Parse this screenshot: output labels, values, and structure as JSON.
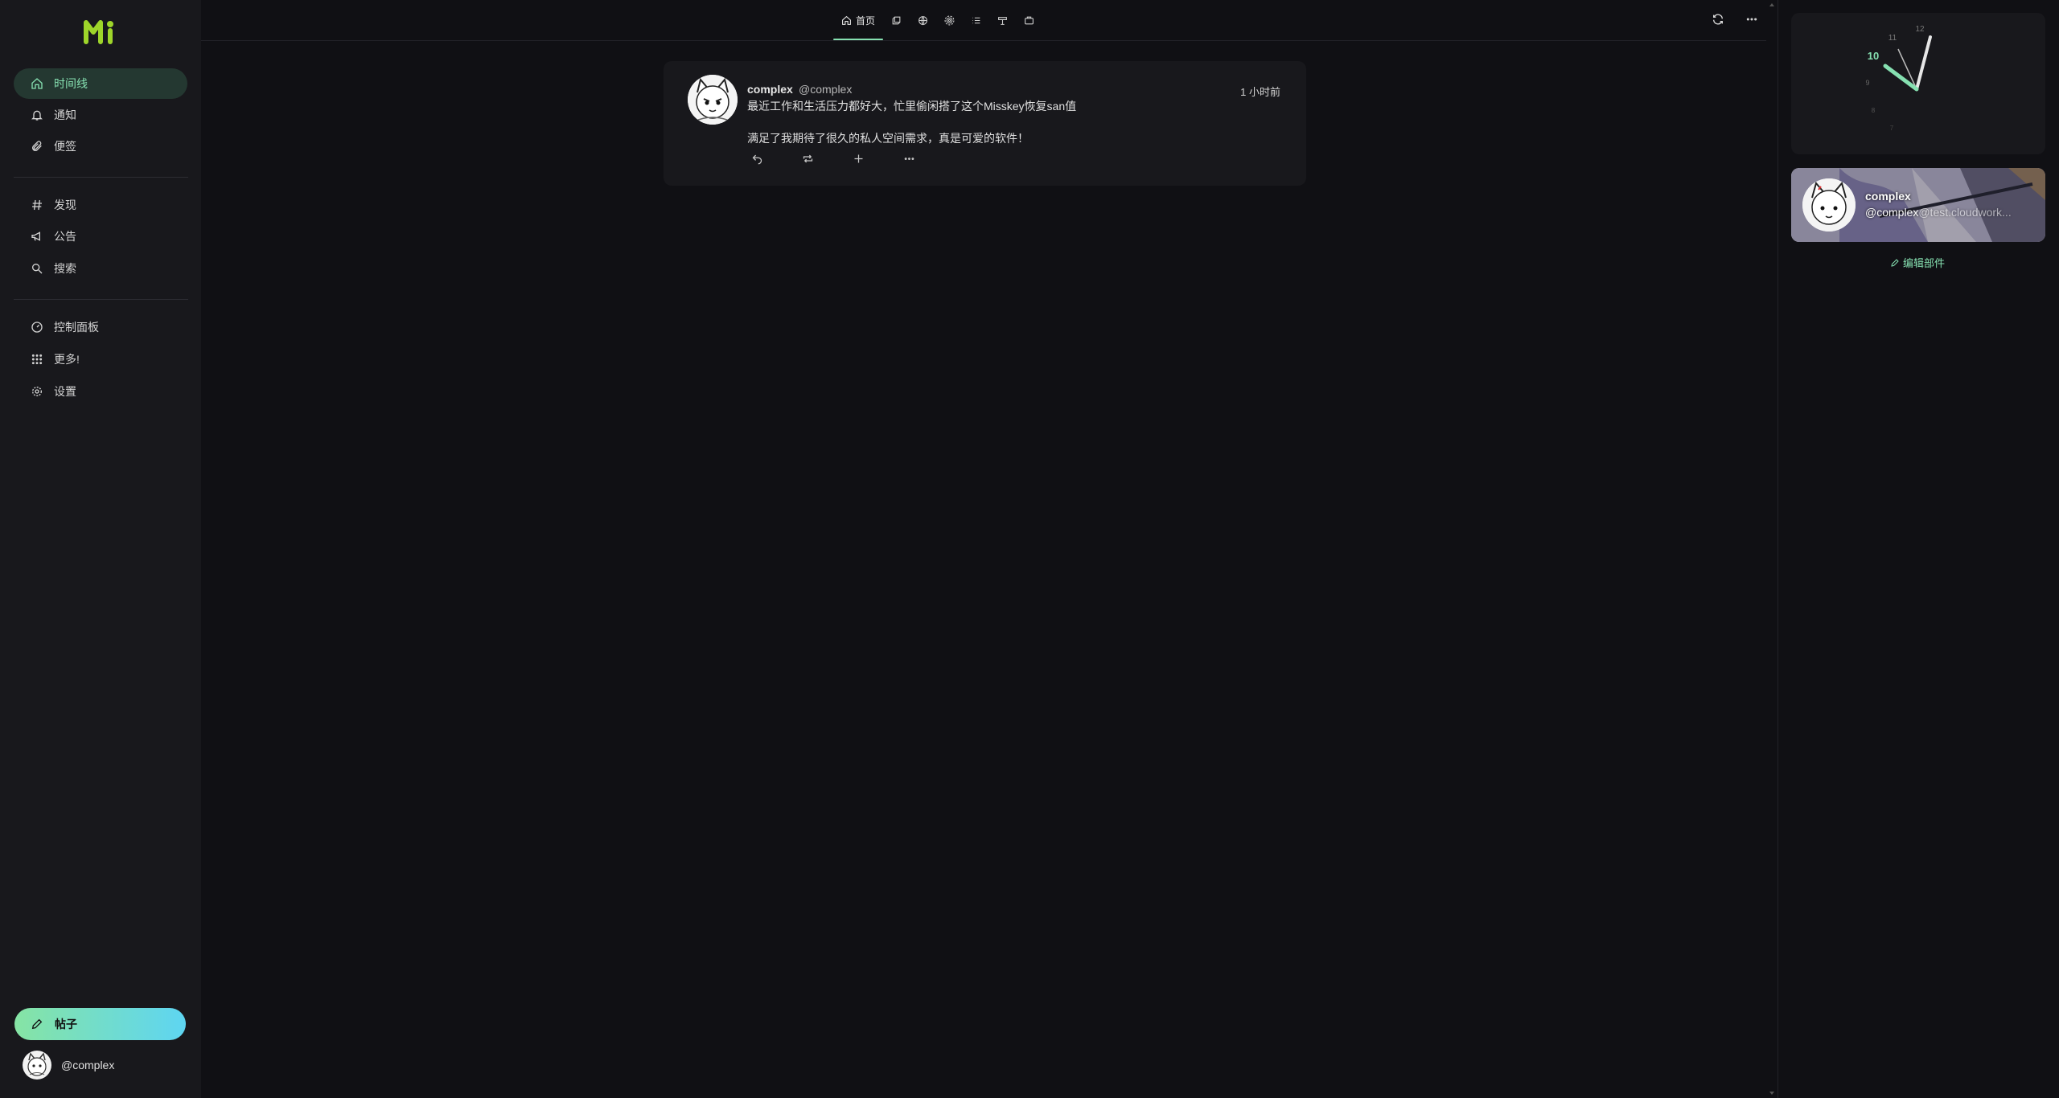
{
  "sidebar": {
    "brand": "Mi",
    "items": [
      {
        "label": "时间线",
        "icon": "home-icon",
        "active": true
      },
      {
        "label": "通知",
        "icon": "bell-icon"
      },
      {
        "label": "便签",
        "icon": "paperclip-icon"
      },
      {
        "label": "发现",
        "icon": "hashtag-icon"
      },
      {
        "label": "公告",
        "icon": "megaphone-icon"
      },
      {
        "label": "搜索",
        "icon": "search-icon"
      },
      {
        "label": "控制面板",
        "icon": "dashboard-icon"
      },
      {
        "label": "更多!",
        "icon": "grid-icon"
      },
      {
        "label": "设置",
        "icon": "gear-icon"
      }
    ],
    "post_button": "帖子",
    "account_handle": "@complex"
  },
  "header": {
    "tabs": [
      {
        "label": "首页",
        "icon": "home-icon",
        "active": true
      },
      {
        "icon": "local-icon"
      },
      {
        "icon": "globe-icon"
      },
      {
        "icon": "antenna-icon"
      },
      {
        "icon": "list-icon"
      },
      {
        "icon": "channel-icon"
      },
      {
        "icon": "role-icon"
      }
    ],
    "actions": [
      "refresh-icon",
      "more-icon"
    ]
  },
  "note": {
    "name": "complex",
    "handle": "@complex",
    "time": "1 小时前",
    "line1": "最近工作和生活压力都好大，忙里偷闲搭了这个Misskey恢复san值",
    "line2": "满足了我期待了很久的私人空间需求，真是可爱的软件！",
    "actions": [
      "reply-icon",
      "renote-icon",
      "reaction-add-icon",
      "more-icon"
    ]
  },
  "widgets": {
    "clock": {
      "numbers": [
        "12",
        "11",
        "10",
        "9",
        "8",
        "7"
      ],
      "highlight": "10"
    },
    "profile": {
      "name": "complex",
      "handle": "@complex",
      "host": "@test.cloudwork..."
    },
    "edit_label": "编辑部件"
  },
  "colors": {
    "accent": "#86e0b1",
    "background": "#101014",
    "panel": "#18181c"
  }
}
